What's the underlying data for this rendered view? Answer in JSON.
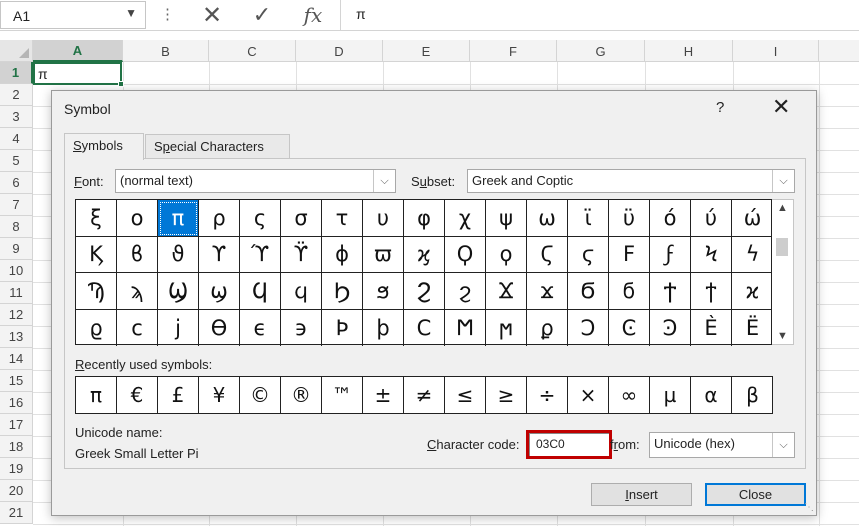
{
  "formula_bar": {
    "name_box": "A1",
    "name_box_arrow": "▼",
    "dots": "⋮",
    "cancel": "✕",
    "enter": "✓",
    "fx": "fx",
    "content": "π"
  },
  "sheet": {
    "columns": [
      "A",
      "B",
      "C",
      "D",
      "E",
      "F",
      "G",
      "H",
      "I"
    ],
    "rows": [
      "1",
      "2",
      "3",
      "4",
      "5",
      "6",
      "7",
      "8",
      "9",
      "10",
      "11",
      "12",
      "13",
      "14",
      "15",
      "16",
      "17",
      "18",
      "19",
      "20",
      "21"
    ],
    "a1_value": "π",
    "accent": "#217346"
  },
  "dialog": {
    "title": "Symbol",
    "help": "?",
    "close": "✕",
    "tabs": {
      "symbols_u": "S",
      "symbols_rest": "ymbols",
      "special_pre": "S",
      "special_u": "p",
      "special_rest": "ecial Characters"
    },
    "font": {
      "label_u": "F",
      "label_rest": "ont:",
      "value": "(normal text)"
    },
    "subset": {
      "label_pre": "S",
      "label_u": "u",
      "label_rest": "bset:",
      "value": "Greek and Coptic"
    },
    "symbols": [
      [
        "ξ",
        "ο",
        "π",
        "ρ",
        "ς",
        "σ",
        "τ",
        "υ",
        "φ",
        "χ",
        "ψ",
        "ω",
        "ϊ",
        "ϋ",
        "ό",
        "ύ",
        "ώ"
      ],
      [
        "Ϗ",
        "ϐ",
        "ϑ",
        "ϒ",
        "ϓ",
        "ϔ",
        "ϕ",
        "ϖ",
        "ϗ",
        "Ϙ",
        "ϙ",
        "Ϛ",
        "ϛ",
        "Ϝ",
        "ϝ",
        "Ϟ",
        "ϟ"
      ],
      [
        "Ϡ",
        "ϡ",
        "Ϣ",
        "ϣ",
        "Ϥ",
        "ϥ",
        "Ϧ",
        "ϧ",
        "Ϩ",
        "ϩ",
        "Ϫ",
        "ϫ",
        "Ϭ",
        "ϭ",
        "Ϯ",
        "ϯ",
        "ϰ"
      ],
      [
        "ϱ",
        "ϲ",
        "ϳ",
        "ϴ",
        "ϵ",
        "϶",
        "Ϸ",
        "ϸ",
        "Ϲ",
        "Ϻ",
        "ϻ",
        "ϼ",
        "Ͻ",
        "Ͼ",
        "Ͽ",
        "Ѐ",
        "Ё"
      ]
    ],
    "selected_symbol": "π",
    "recent": {
      "label_u": "R",
      "label_rest": "ecently used symbols:",
      "items": [
        "π",
        "€",
        "£",
        "¥",
        "©",
        "®",
        "™",
        "±",
        "≠",
        "≤",
        "≥",
        "÷",
        "×",
        "∞",
        "µ",
        "α",
        "β"
      ]
    },
    "unicode_name_label": "Unicode name:",
    "unicode_name_value": "Greek Small Letter Pi",
    "char_code": {
      "label_u": "C",
      "label_rest": "haracter code:",
      "value": "03C0"
    },
    "from": {
      "label_pre": "f",
      "label_u": "r",
      "label_rest": "om:",
      "value": "Unicode (hex)"
    },
    "buttons": {
      "insert_u": "I",
      "insert_rest": "nsert",
      "close": "Close"
    },
    "highlight_color": "#c00000"
  }
}
